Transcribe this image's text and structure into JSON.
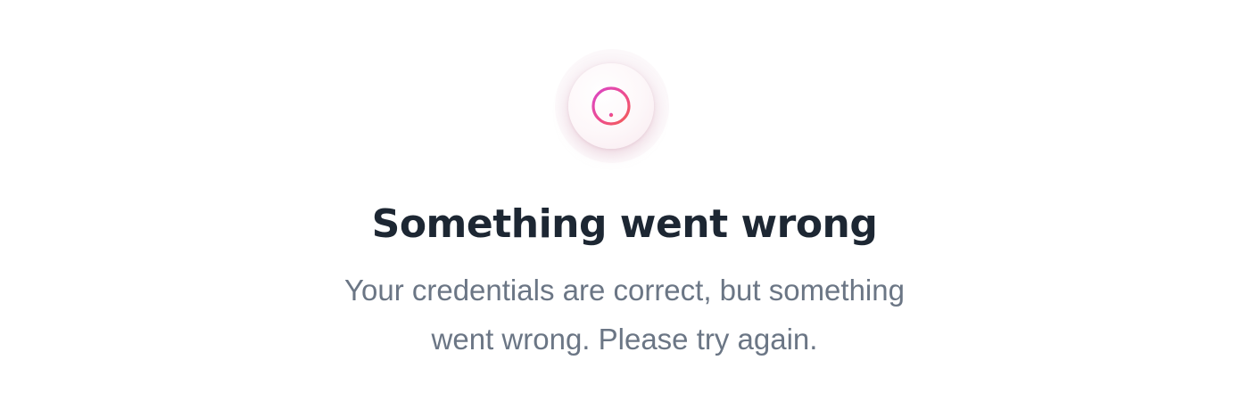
{
  "error": {
    "icon": "alert-circle-icon",
    "title": "Something went wrong",
    "message_line1": "Your credentials are correct, but something",
    "message_line2": "went wrong. Please try again."
  },
  "colors": {
    "icon_gradient_start": "#ee4d8c",
    "icon_gradient_end": "#f25c54",
    "title": "#1d2733",
    "message": "#6b7685"
  }
}
